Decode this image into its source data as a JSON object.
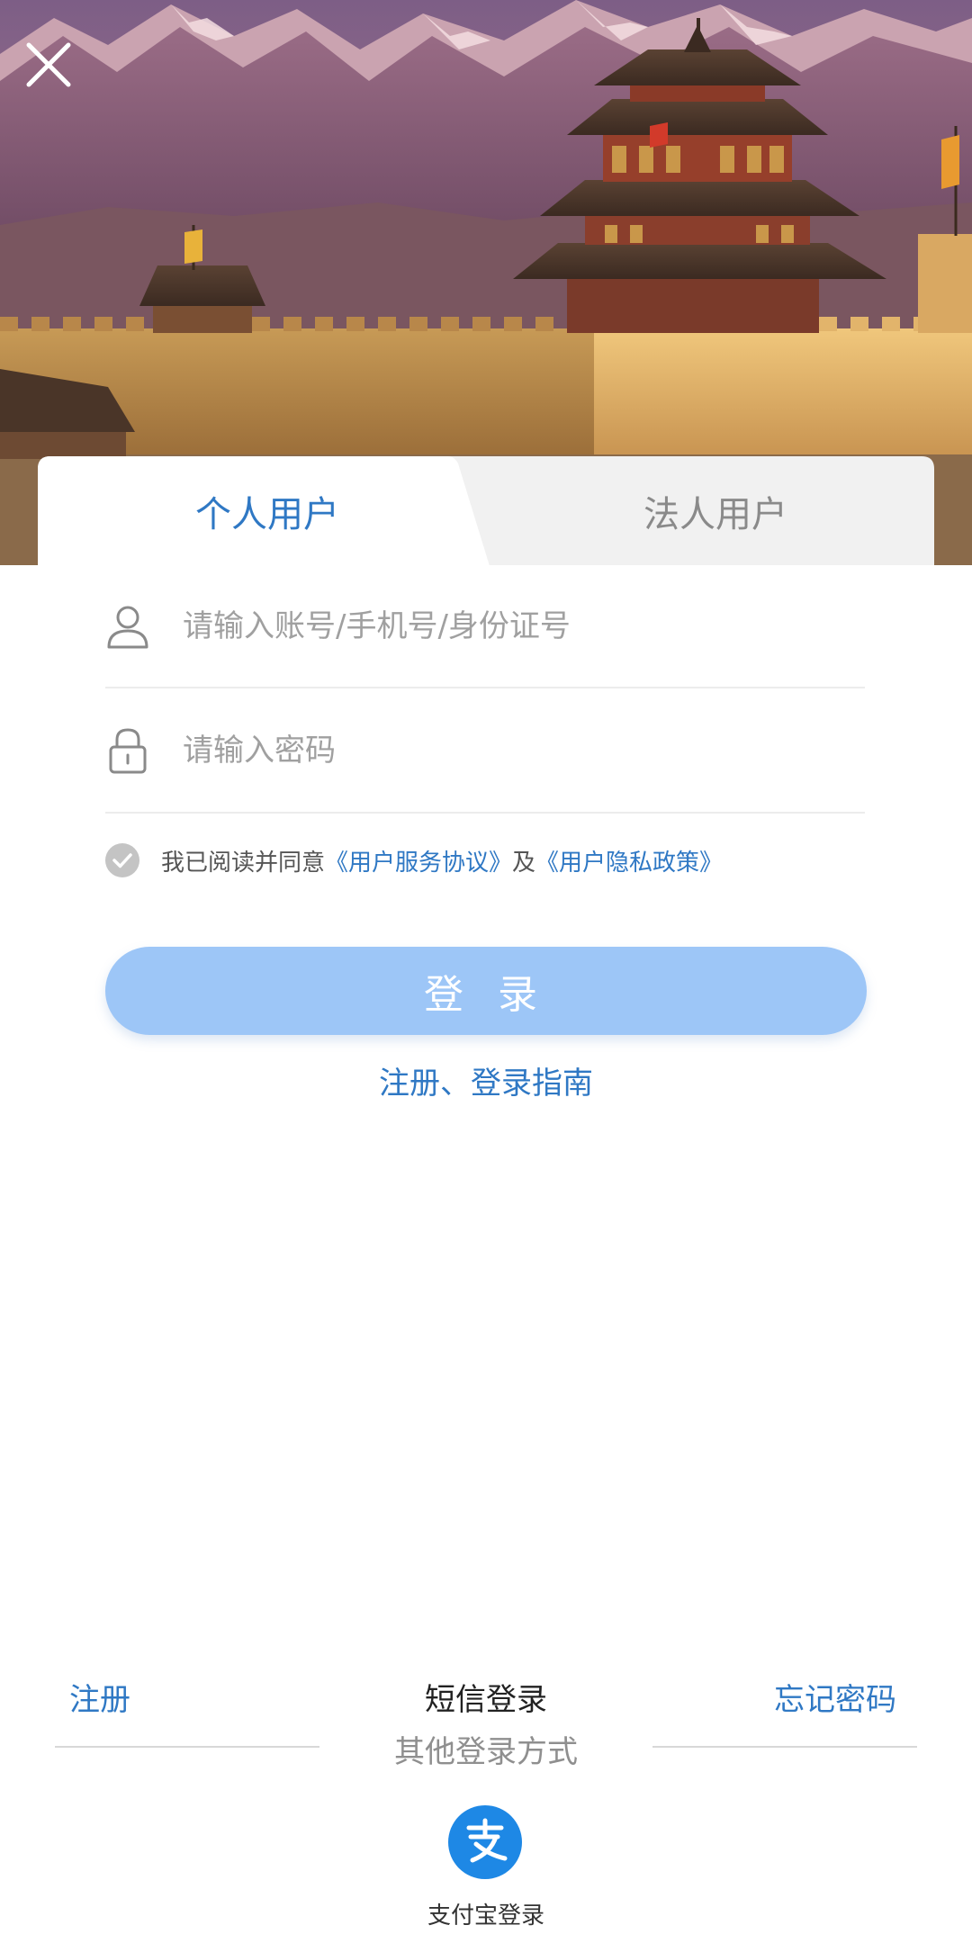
{
  "tabs": {
    "personal": "个人用户",
    "corporate": "法人用户"
  },
  "form": {
    "account_placeholder": "请输入账号/手机号/身份证号",
    "password_placeholder": "请输入密码"
  },
  "agreement": {
    "prefix": "我已阅读并同意",
    "service_link": "《用户服务协议》",
    "conjunction": "及",
    "privacy_link": "《用户隐私政策》"
  },
  "login_button": "登 录",
  "guide_link": "注册、登录指南",
  "bottom": {
    "register": "注册",
    "sms_login": "短信登录",
    "forgot_password": "忘记密码",
    "other_methods": "其他登录方式",
    "alipay_label": "支付宝登录"
  },
  "icons": {
    "close": "close-icon",
    "user": "user-icon",
    "lock": "lock-icon",
    "check": "check-icon",
    "alipay": "alipay-icon"
  },
  "colors": {
    "accent": "#2f78c4",
    "login_button": "#9dc6f7",
    "alipay": "#1e88e5",
    "placeholder": "#a0a0a0"
  }
}
